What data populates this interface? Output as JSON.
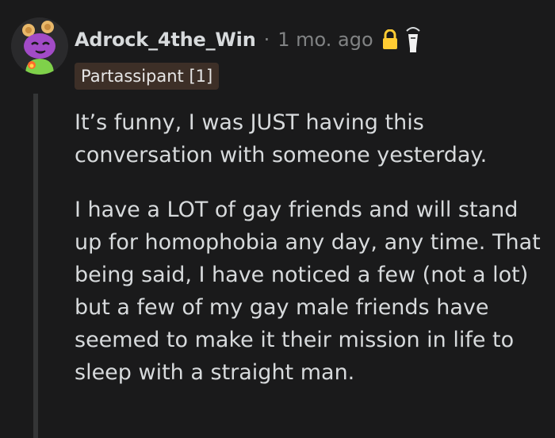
{
  "comment": {
    "username": "Adrock_4the_Win",
    "separator": "·",
    "time": "1 mo. ago",
    "flair": "Partassipant [1]",
    "icons": [
      "avatar",
      "lock-icon",
      "award-icon"
    ],
    "paragraphs": [
      "It’s funny, I was JUST having this conversation with someone yesterday.",
      "I have a LOT of gay friends and will stand up for homophobia any day, any time. That being said, I have noticed a few (not a lot) but a few of my gay male friends have seemed to make it their mission in life to sleep with a straight man."
    ]
  },
  "colors": {
    "background": "#1a1a1b",
    "text": "#d7dadc",
    "meta": "#818384",
    "flair_bg": "#3d2f27",
    "lock": "#ffcc33",
    "thread_line": "#343536"
  }
}
